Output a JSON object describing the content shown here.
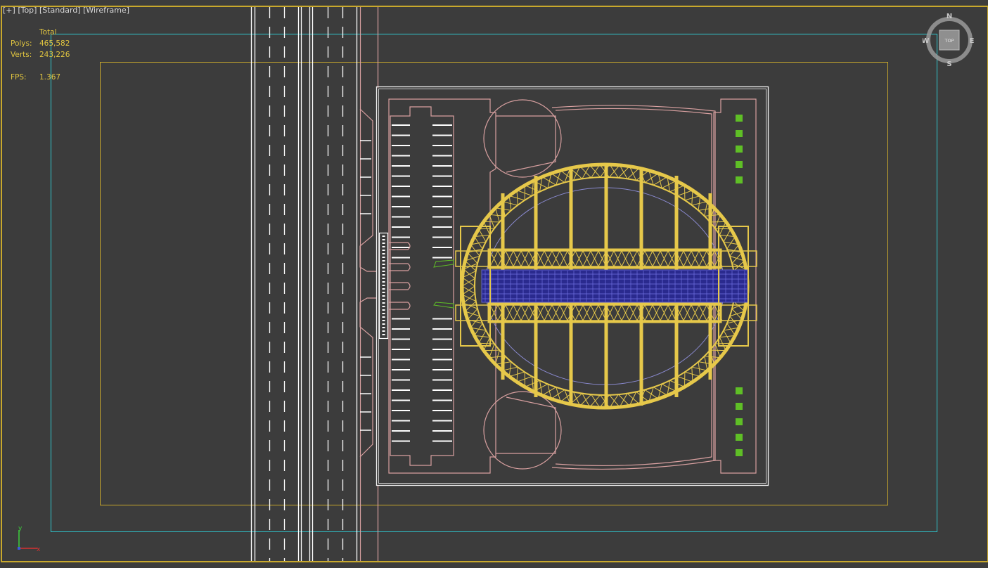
{
  "viewport": {
    "label_plus": "[+]",
    "label_view": "[Top]",
    "label_shading": "[Standard]",
    "label_mode": "[Wireframe]"
  },
  "stats": {
    "header": "Total",
    "polys_label": "Polys:",
    "polys_value": "465,582",
    "verts_label": "Verts:",
    "verts_value": "243,226",
    "fps_label": "FPS:",
    "fps_value": "1.367"
  },
  "viewcube": {
    "face": "TOP",
    "north": "N",
    "south": "S",
    "east": "E",
    "west": "W"
  },
  "axis_gizmo": {
    "x": "x",
    "y": "y"
  },
  "colors": {
    "background": "#3c3c3c",
    "border_active": "#c8a82c",
    "safe_frame": "#2fc7cf",
    "site_outline": "#d8a0a0",
    "structure": "#e6c84a",
    "roof_glass": "#2a2a8e",
    "green_markers": "#5fbf26",
    "road_lines": "#ffffff"
  }
}
